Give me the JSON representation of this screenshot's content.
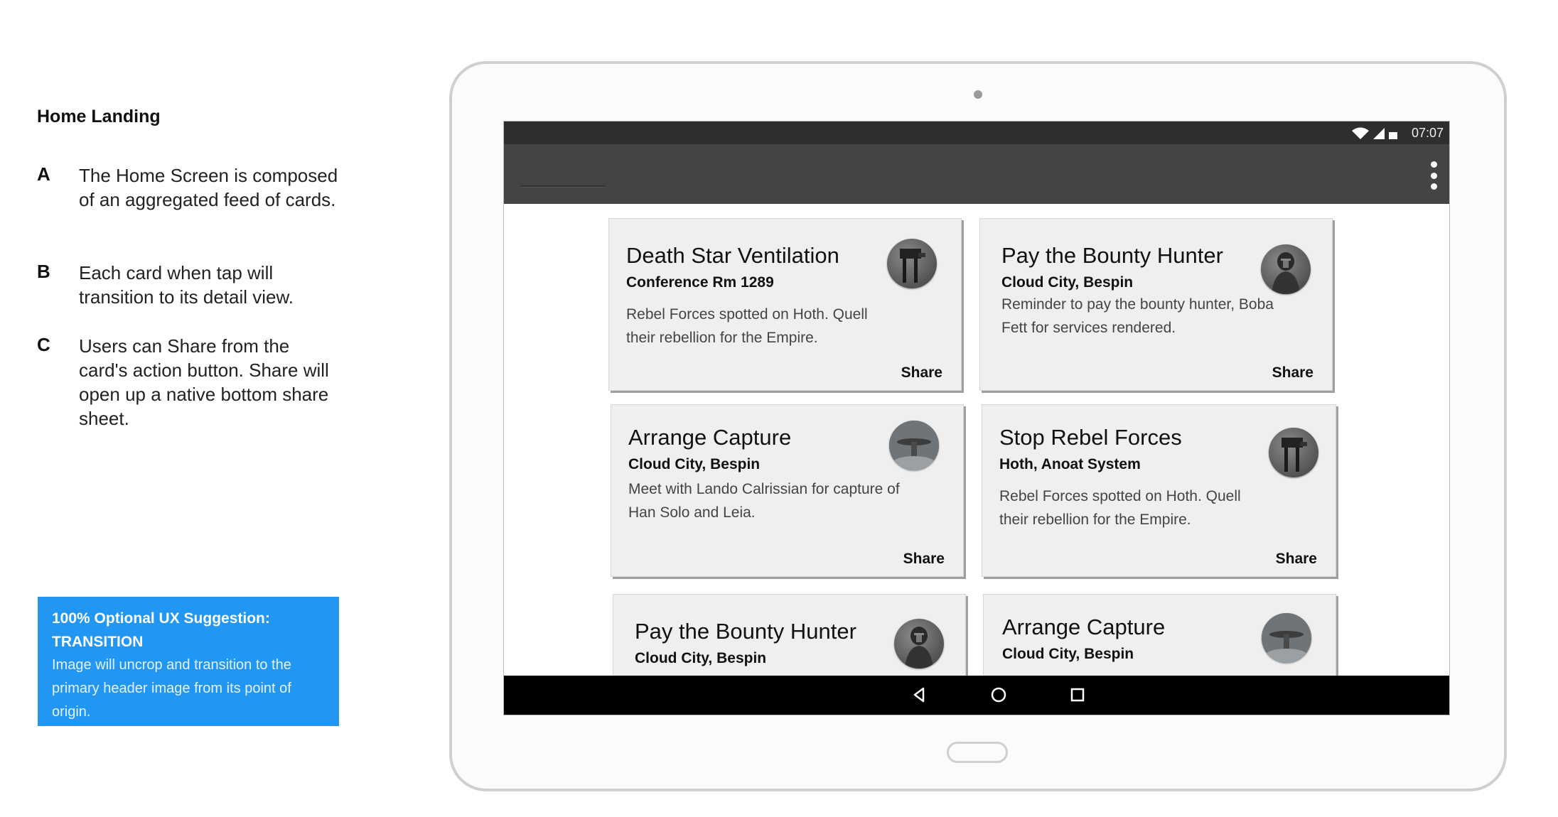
{
  "annotation": {
    "title": "Home Landing",
    "notes": [
      {
        "letter": "A",
        "text": "The Home Screen is composed of an aggregated feed of cards."
      },
      {
        "letter": "B",
        "text": "Each card when tap will transition to its detail view."
      },
      {
        "letter": "C",
        "text": "Users can Share from the card's action button. Share will open up a native bottom share sheet."
      }
    ],
    "suggestion": {
      "title": "100% Optional UX Suggestion: TRANSITION",
      "body": "Image will uncrop and transition to the primary header image from its point of origin."
    }
  },
  "status_bar": {
    "time": "07:07",
    "icons": [
      "wifi-icon",
      "signal-icon",
      "battery-icon"
    ]
  },
  "app_bar": {
    "menu_icon": "overflow-menu-icon"
  },
  "cards": [
    {
      "title": "Death Star Ventilation",
      "subtitle": "Conference Rm 1289",
      "body": "Rebel Forces spotted on Hoth. Quell their rebellion for the Empire.",
      "action": "Share",
      "avatar": "walker-avatar-icon"
    },
    {
      "title": "Pay the Bounty Hunter",
      "subtitle": "Cloud City, Bespin",
      "body": "Reminder to pay the bounty hunter, Boba Fett for services rendered.",
      "action": "Share",
      "avatar": "bounty-hunter-avatar-icon"
    },
    {
      "title": "Arrange Capture",
      "subtitle": "Cloud City, Bespin",
      "body": "Meet with Lando Calrissian for capture of Han Solo and Leia.",
      "action": "Share",
      "avatar": "cloud-city-avatar-icon"
    },
    {
      "title": "Stop Rebel Forces",
      "subtitle": "Hoth, Anoat System",
      "body": "Rebel Forces spotted on Hoth. Quell their rebellion for the Empire.",
      "action": "Share",
      "avatar": "walker-avatar-icon"
    },
    {
      "title": "Pay the Bounty Hunter",
      "subtitle": "Cloud City, Bespin",
      "body": "",
      "action": "",
      "avatar": "bounty-hunter-avatar-icon"
    },
    {
      "title": "Arrange Capture",
      "subtitle": "Cloud City, Bespin",
      "body": "",
      "action": "",
      "avatar": "cloud-city-avatar-icon"
    }
  ],
  "nav_bar": {
    "icons": [
      "back-icon",
      "home-icon",
      "recents-icon"
    ]
  },
  "colors": {
    "suggestion_bg": "#2196f3",
    "status_bar": "#2e2e2e",
    "app_bar": "#444444",
    "nav_bar": "#000000",
    "card_bg": "#efefef"
  }
}
